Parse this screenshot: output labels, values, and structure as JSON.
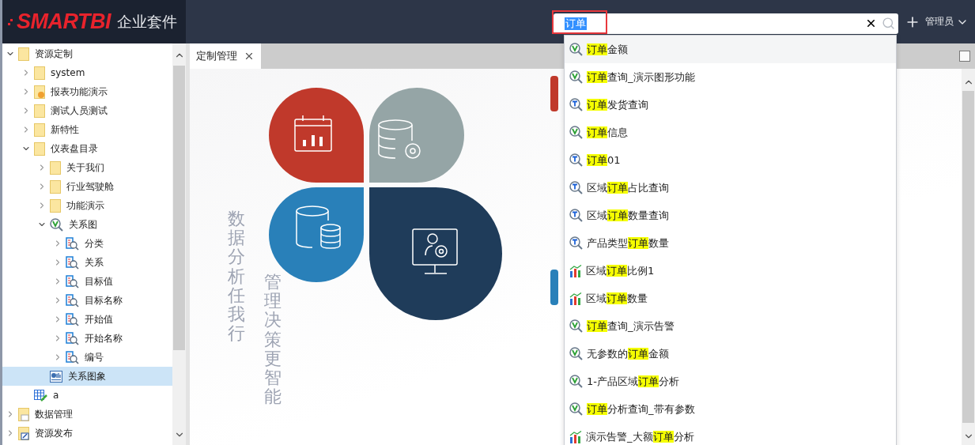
{
  "header": {
    "logo": "SMARTBI",
    "product": "企业套件",
    "search": {
      "value": "订单",
      "text_selected": true,
      "annotated": true
    },
    "user": "管理员"
  },
  "tree": [
    {
      "label": "资源定制",
      "kind": "folder",
      "expandable": true,
      "expanded": true,
      "selected": false,
      "children": [
        {
          "label": "system",
          "kind": "folder",
          "expandable": true,
          "expanded": false,
          "selected": false
        },
        {
          "label": "报表功能演示",
          "kind": "folder-report",
          "expandable": true,
          "expanded": false,
          "selected": false
        },
        {
          "label": "测试人员测试",
          "kind": "folder",
          "expandable": true,
          "expanded": false,
          "selected": false
        },
        {
          "label": "新特性",
          "kind": "folder",
          "expandable": true,
          "expanded": false,
          "selected": false
        },
        {
          "label": "仪表盘目录",
          "kind": "folder",
          "expandable": true,
          "expanded": true,
          "selected": false,
          "children": [
            {
              "label": "关于我们",
              "kind": "folder",
              "expandable": true,
              "expanded": false,
              "selected": false
            },
            {
              "label": "行业驾驶舱",
              "kind": "folder",
              "expandable": true,
              "expanded": false,
              "selected": false
            },
            {
              "label": "功能演示",
              "kind": "folder",
              "expandable": true,
              "expanded": false,
              "selected": false
            },
            {
              "label": "关系图",
              "kind": "view",
              "expandable": true,
              "expanded": true,
              "selected": false,
              "children": [
                {
                  "label": "分类",
                  "kind": "query",
                  "expandable": true,
                  "expanded": false,
                  "selected": false
                },
                {
                  "label": "关系",
                  "kind": "query",
                  "expandable": true,
                  "expanded": false,
                  "selected": false
                },
                {
                  "label": "目标值",
                  "kind": "query",
                  "expandable": true,
                  "expanded": false,
                  "selected": false
                },
                {
                  "label": "目标名称",
                  "kind": "query",
                  "expandable": true,
                  "expanded": false,
                  "selected": false
                },
                {
                  "label": "开始值",
                  "kind": "query",
                  "expandable": true,
                  "expanded": false,
                  "selected": false
                },
                {
                  "label": "开始名称",
                  "kind": "query",
                  "expandable": true,
                  "expanded": false,
                  "selected": false
                },
                {
                  "label": "编号",
                  "kind": "query",
                  "expandable": true,
                  "expanded": false,
                  "selected": false
                }
              ]
            },
            {
              "label": "关系图象",
              "kind": "chart-doc",
              "expandable": false,
              "selected": true
            }
          ]
        },
        {
          "label": "a",
          "kind": "table-edit",
          "expandable": false,
          "selected": false
        }
      ]
    },
    {
      "label": "数据管理",
      "kind": "folder-data",
      "expandable": true,
      "expanded": false,
      "selected": false
    },
    {
      "label": "资源发布",
      "kind": "folder-publish",
      "expandable": true,
      "expanded": false,
      "selected": false
    }
  ],
  "tabs": [
    {
      "label": "定制管理",
      "selected": true
    }
  ],
  "slogans": [
    "数据分析任我行",
    "管理决策更智能"
  ],
  "suggestions": [
    {
      "kind": "view",
      "parts": [
        {
          "text": "订单",
          "match": true
        },
        {
          "text": "金额",
          "match": false
        }
      ]
    },
    {
      "kind": "view",
      "parts": [
        {
          "text": "订单",
          "match": true
        },
        {
          "text": "查询_演示图形功能",
          "match": false
        }
      ]
    },
    {
      "kind": "query",
      "parts": [
        {
          "text": "订单",
          "match": true
        },
        {
          "text": "发货查询",
          "match": false
        }
      ]
    },
    {
      "kind": "view",
      "parts": [
        {
          "text": "订单",
          "match": true
        },
        {
          "text": "信息",
          "match": false
        }
      ]
    },
    {
      "kind": "query",
      "parts": [
        {
          "text": "订单",
          "match": true
        },
        {
          "text": "01",
          "match": false
        }
      ]
    },
    {
      "kind": "query",
      "parts": [
        {
          "text": "区域",
          "match": false
        },
        {
          "text": "订单",
          "match": true
        },
        {
          "text": "占比查询",
          "match": false
        }
      ]
    },
    {
      "kind": "query",
      "parts": [
        {
          "text": "区域",
          "match": false
        },
        {
          "text": "订单",
          "match": true
        },
        {
          "text": "数量查询",
          "match": false
        }
      ]
    },
    {
      "kind": "query",
      "parts": [
        {
          "text": "产品类型",
          "match": false
        },
        {
          "text": "订单",
          "match": true
        },
        {
          "text": "数量",
          "match": false
        }
      ]
    },
    {
      "kind": "chart",
      "parts": [
        {
          "text": "区域",
          "match": false
        },
        {
          "text": "订单",
          "match": true
        },
        {
          "text": "比例1",
          "match": false
        }
      ]
    },
    {
      "kind": "chart",
      "parts": [
        {
          "text": "区域",
          "match": false
        },
        {
          "text": "订单",
          "match": true
        },
        {
          "text": "数量",
          "match": false
        }
      ]
    },
    {
      "kind": "view",
      "parts": [
        {
          "text": "订单",
          "match": true
        },
        {
          "text": "查询_演示告警",
          "match": false
        }
      ]
    },
    {
      "kind": "view",
      "parts": [
        {
          "text": "无参数的",
          "match": false
        },
        {
          "text": "订单",
          "match": true
        },
        {
          "text": "金额",
          "match": false
        }
      ]
    },
    {
      "kind": "view",
      "parts": [
        {
          "text": "1-产品区域",
          "match": false
        },
        {
          "text": "订单",
          "match": true
        },
        {
          "text": "分析",
          "match": false
        }
      ]
    },
    {
      "kind": "view",
      "parts": [
        {
          "text": "订单",
          "match": true
        },
        {
          "text": "分析查询_带有参数",
          "match": false
        }
      ]
    },
    {
      "kind": "chart",
      "parts": [
        {
          "text": "演示告警_大额",
          "match": false
        },
        {
          "text": "订单",
          "match": true
        },
        {
          "text": "分析",
          "match": false
        }
      ]
    }
  ]
}
